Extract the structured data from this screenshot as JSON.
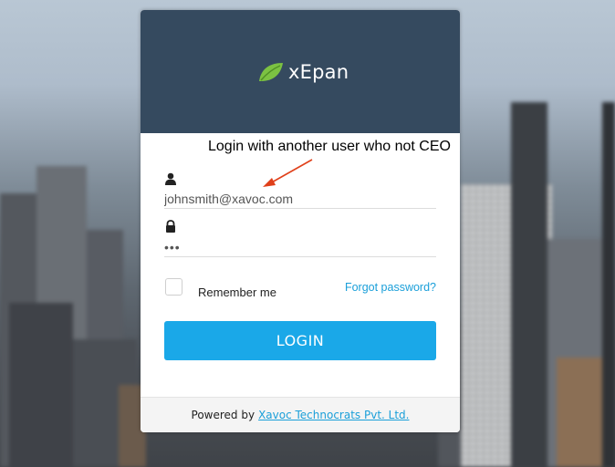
{
  "brand": {
    "name": "xEpan",
    "leaf_color": "#7cc242"
  },
  "annotation": {
    "text": "Login with another user who not CEO",
    "arrow_color": "#e0401a"
  },
  "form": {
    "user_icon": "user-icon",
    "email_value": "johnsmith@xavoc.com",
    "lock_icon": "lock-icon",
    "password_value": "•••",
    "remember_label": "Remember me",
    "remember_checked": false,
    "forgot_label": "Forgot password?",
    "login_label": "LOGIN"
  },
  "footer": {
    "prefix": "Powered by",
    "company_link": "Xavoc Technocrats Pvt. Ltd."
  },
  "colors": {
    "header_bg": "#354a5f",
    "accent": "#1aa8e8",
    "link": "#1a9fd9"
  }
}
